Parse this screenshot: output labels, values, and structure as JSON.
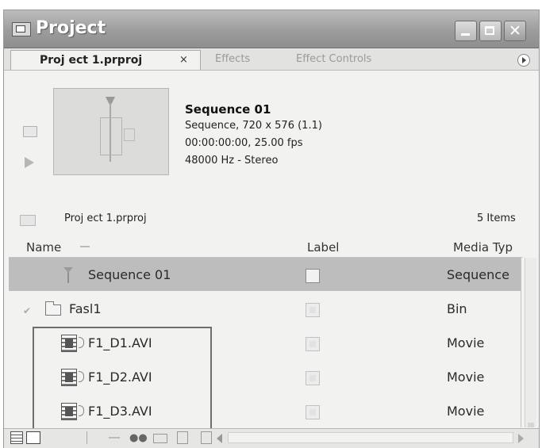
{
  "window": {
    "title": "Project"
  },
  "tabs": [
    {
      "label": "Proj ect 1.prproj"
    },
    {
      "label": "Effects"
    },
    {
      "label": "Effect Controls"
    }
  ],
  "tab_close": "×",
  "preview": {
    "name": "Sequence 01",
    "line1": "Sequence, 720 x 576 (1.1)",
    "line2": "00:00:00:00, 25.00 fps",
    "line3": "48000 Hz - Stereo"
  },
  "project": {
    "path": "Proj ect 1.prproj",
    "count": "5 Items"
  },
  "columns": {
    "name": "Name",
    "label": "Label",
    "media_type": "Media Typ"
  },
  "rows": [
    {
      "name": "Sequence 01",
      "type": "Sequence",
      "selected": true
    },
    {
      "name": "Fasl1",
      "type": "Bin"
    },
    {
      "name": "F1_D1.AVI",
      "type": "Movie"
    },
    {
      "name": "F1_D2.AVI",
      "type": "Movie"
    },
    {
      "name": "F1_D3.AVI",
      "type": "Movie"
    }
  ],
  "icons": {
    "sequence": "sequence-icon",
    "bin": "folder-icon",
    "movie": "movie-clip-icon",
    "find": "binoculars-icon",
    "delete": "trash-icon"
  },
  "colors": {
    "titlebar": "#9c9c9c",
    "selected_row": "#bdbdbd"
  }
}
